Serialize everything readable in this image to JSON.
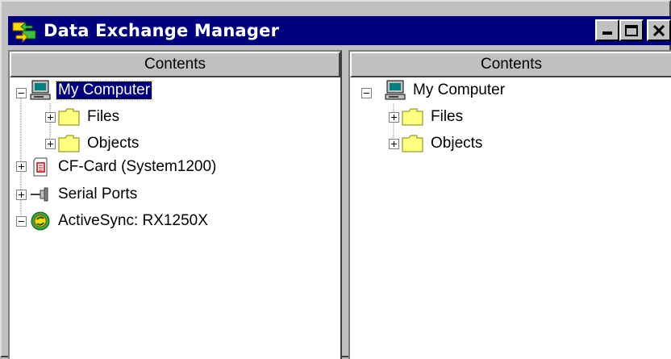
{
  "window": {
    "title": "Data Exchange Manager",
    "buttons": [
      "minimize",
      "maximize",
      "close"
    ]
  },
  "left_pane": {
    "header": "Contents",
    "tree": [
      {
        "label": "My Computer",
        "icon": "computer-icon",
        "expanded": true,
        "selected": true
      },
      {
        "label": "Files",
        "icon": "folder-icon",
        "expanded": false
      },
      {
        "label": "Objects",
        "icon": "folder-icon",
        "expanded": false
      },
      {
        "label": "CF-Card (System1200)",
        "icon": "cf-card-icon",
        "expanded": false
      },
      {
        "label": "Serial Ports",
        "icon": "serial-port-icon",
        "expanded": false
      },
      {
        "label": "ActiveSync: RX1250X",
        "icon": "activesync-icon",
        "expanded": true
      }
    ]
  },
  "right_pane": {
    "header": "Contents",
    "tree": [
      {
        "label": "My Computer",
        "icon": "computer-icon",
        "expanded": true
      },
      {
        "label": "Files",
        "icon": "folder-icon",
        "expanded": false
      },
      {
        "label": "Objects",
        "icon": "folder-icon",
        "expanded": false
      }
    ]
  },
  "colors": {
    "titlebar": "#00007e",
    "selection": "#00007e",
    "chrome": "#c0c0c0",
    "folder": "#ffff80"
  }
}
